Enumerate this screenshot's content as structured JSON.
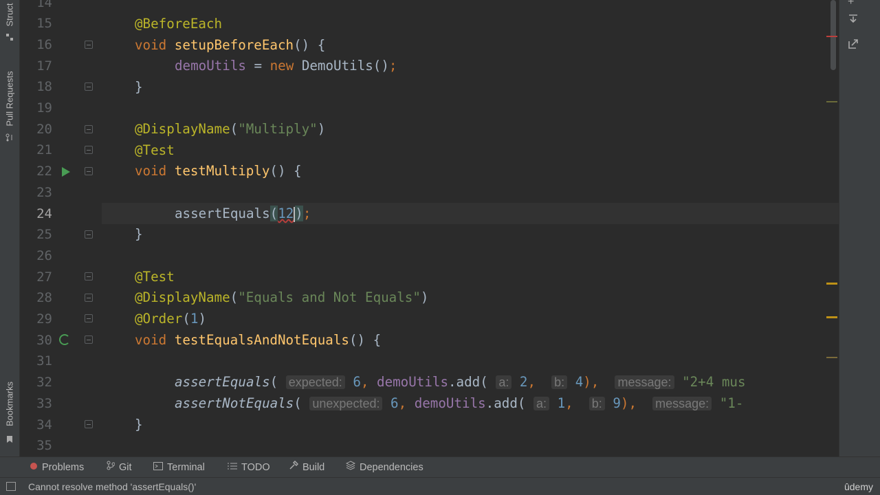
{
  "left_tabs": {
    "structure": "Struct",
    "pull_requests": "Pull Requests",
    "bookmarks": "Bookmarks"
  },
  "editor": {
    "current_line": 24,
    "lines": [
      {
        "n": "14"
      },
      {
        "n": "15"
      },
      {
        "n": "16"
      },
      {
        "n": "17"
      },
      {
        "n": "18"
      },
      {
        "n": "19"
      },
      {
        "n": "20"
      },
      {
        "n": "21"
      },
      {
        "n": "22"
      },
      {
        "n": "23"
      },
      {
        "n": "24"
      },
      {
        "n": "25"
      },
      {
        "n": "26"
      },
      {
        "n": "27"
      },
      {
        "n": "28"
      },
      {
        "n": "29"
      },
      {
        "n": "30"
      },
      {
        "n": "31"
      },
      {
        "n": "32"
      },
      {
        "n": "33"
      },
      {
        "n": "34"
      },
      {
        "n": "35"
      }
    ],
    "code": {
      "l15": "@BeforeEach",
      "l16_kw": "void",
      "l16_fn": "setupBeforeEach",
      "l16_rest": "() {",
      "l17_fld": "demoUtils",
      "l17_eq": " = ",
      "l17_kw": "new",
      "l17_rest": " DemoUtils()",
      "l17_semi": ";",
      "l18": "}",
      "l20_ann": "@DisplayName",
      "l20_open": "(",
      "l20_str": "\"Multiply\"",
      "l20_close": ")",
      "l21": "@Test",
      "l22_kw": "void",
      "l22_fn": "testMultiply",
      "l22_rest": "() {",
      "l24_call": "assertEquals",
      "l24_open": "(",
      "l24_num": "12",
      "l24_close": ")",
      "l24_semi": ";",
      "l25": "}",
      "l27": "@Test",
      "l28_ann": "@DisplayName",
      "l28_open": "(",
      "l28_str": "\"Equals and Not Equals\"",
      "l28_close": ")",
      "l29_ann": "@Order",
      "l29_open": "(",
      "l29_num": "1",
      "l29_close": ")",
      "l30_kw": "void",
      "l30_fn": "testEqualsAndNotEquals",
      "l30_rest": "() {",
      "l32_call": "assertEquals",
      "l32_open": "( ",
      "l32_hint1": "expected:",
      "l32_v1": "6",
      "l32_c1": ", ",
      "l32_fld": "demoUtils",
      "l32_dot": ".add( ",
      "l32_hint2": "a:",
      "l32_v2": "2",
      "l32_c2": ",  ",
      "l32_hint3": "b:",
      "l32_v3": "4",
      "l32_c3": "),  ",
      "l32_hint4": "message:",
      "l32_str": "\"2+4 mus",
      "l33_call": "assertNotEquals",
      "l33_open": "( ",
      "l33_hint1": "unexpected:",
      "l33_v1": "6",
      "l33_c1": ", ",
      "l33_fld": "demoUtils",
      "l33_dot": ".add( ",
      "l33_hint2": "a:",
      "l33_v2": "1",
      "l33_c2": ",  ",
      "l33_hint3": "b:",
      "l33_v3": "9",
      "l33_c3": "),  ",
      "l33_hint4": "message:",
      "l33_str": "\"1-",
      "l34": "}"
    }
  },
  "tool_windows": [
    {
      "label": "Problems",
      "icon": "problems-icon"
    },
    {
      "label": "Git",
      "icon": "git-icon"
    },
    {
      "label": "Terminal",
      "icon": "terminal-icon"
    },
    {
      "label": "TODO",
      "icon": "todo-icon"
    },
    {
      "label": "Build",
      "icon": "build-icon"
    },
    {
      "label": "Dependencies",
      "icon": "dependencies-icon"
    }
  ],
  "status": {
    "message": "Cannot resolve method 'assertEquals()'",
    "watermark": "ûdemy"
  },
  "colors": {
    "keyword": "#cc7832",
    "annotation": "#bbb529",
    "function": "#ffc66d",
    "string": "#6a8759",
    "number": "#6897bb",
    "field": "#9876aa",
    "background": "#2b2b2b"
  }
}
